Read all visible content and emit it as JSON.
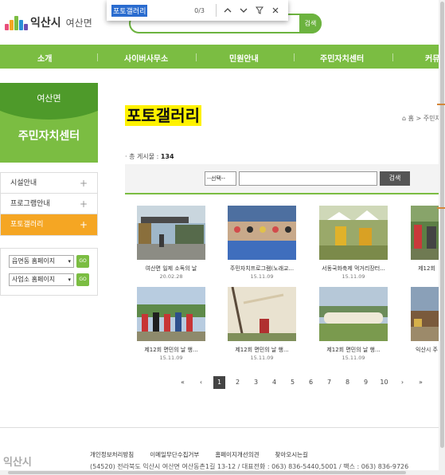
{
  "header": {
    "logo_text": "익산시",
    "logo_sub": "여산면",
    "search_button": "검색"
  },
  "findbar": {
    "query": "포토갤러리",
    "count": "0/3",
    "prev_icon": "chevron-up-icon",
    "next_icon": "chevron-down-icon",
    "filter_icon": "filter-icon",
    "close_icon": "close-icon"
  },
  "gnb": {
    "items": [
      "소개",
      "사이버사무소",
      "민원안내",
      "주민자치센터",
      "커뮤"
    ]
  },
  "lnb": {
    "area": "여산면",
    "title": "주민자치센터",
    "items": [
      "시설안내",
      "프로그램안내",
      "포토갤러리"
    ],
    "quick": [
      {
        "label": "읍면동 홈페이지",
        "go": "GO"
      },
      {
        "label": "사업소 홈페이지",
        "go": "GO"
      }
    ]
  },
  "content": {
    "title": "포토갤러리",
    "breadcrumb": "홈 > 주민자",
    "total_label": "· 총 게시물 :",
    "total_count": "134",
    "select_label": "--선택--",
    "search_button": "검색"
  },
  "gallery": [
    {
      "caption": "여산면 일제 소독의 날",
      "date": "20.02.28"
    },
    {
      "caption": "주민자치프로그램(노래교...",
      "date": "15.11.09"
    },
    {
      "caption": "서동국화축제 먹거리장터...",
      "date": "15.11.09"
    },
    {
      "caption": "제12회",
      "date": ""
    },
    {
      "caption": "제12회 면민의 날 행...",
      "date": "15.11.09"
    },
    {
      "caption": "제12회 면민의 날 행...",
      "date": "15.11.09"
    },
    {
      "caption": "제12회 면민의 날 행...",
      "date": "15.11.09"
    },
    {
      "caption": "익산시 주",
      "date": ""
    }
  ],
  "pager": {
    "first": "«",
    "prev": "‹",
    "pages": [
      "1",
      "2",
      "3",
      "4",
      "5",
      "6",
      "7",
      "8",
      "9",
      "10"
    ],
    "next": "›",
    "last": "»",
    "current": "1"
  },
  "footer": {
    "logo": "익산시",
    "links": [
      "개인정보처리방침",
      "이메일무단수집거부",
      "홈페이지개선의견",
      "찾아오시는길"
    ],
    "address": "(54520) 전라북도 익산시 여산면 여산동촌1길 13-12 / 대표전화 : 063) 836-5440,5001 / 팩스 : 063) 836-9726"
  },
  "colors": {
    "accent_green": "#7bbd42",
    "active_orange": "#f5a623",
    "highlight_yellow": "#fff200"
  }
}
